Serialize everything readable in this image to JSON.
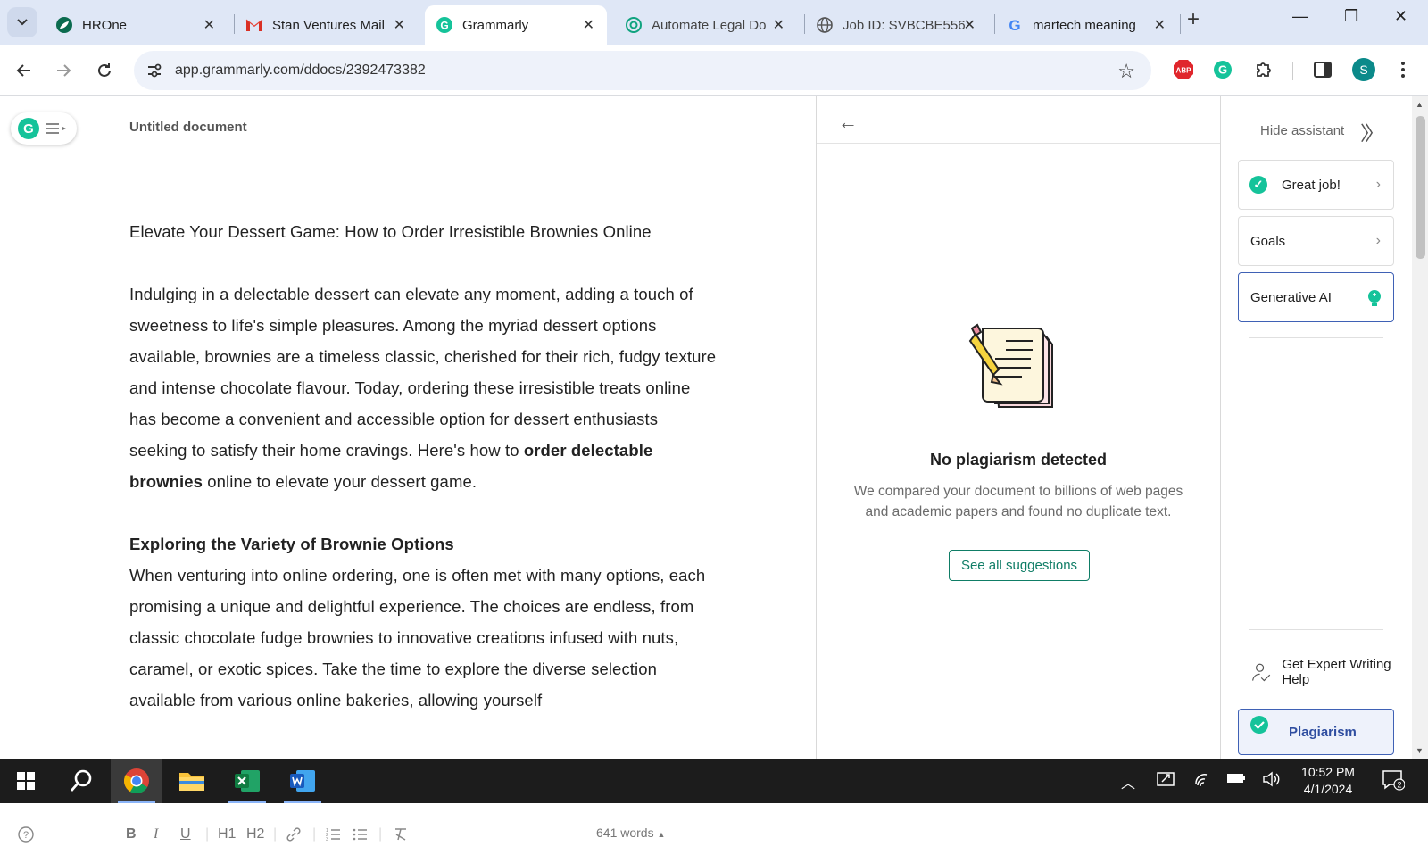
{
  "browser": {
    "tabs": [
      {
        "title": "HROne",
        "icon": "hrone-logo-icon"
      },
      {
        "title": "Stan Ventures Mail",
        "icon": "gmail-icon"
      },
      {
        "title": "Grammarly",
        "icon": "grammarly-icon",
        "active": true
      },
      {
        "title": "Automate Legal Do",
        "icon": "chatgpt-icon"
      },
      {
        "title": "Job ID: SVBCBE556",
        "icon": "globe-icon"
      },
      {
        "title": "martech meaning",
        "icon": "google-icon"
      }
    ],
    "url": "app.grammarly.com/ddocs/2392473382"
  },
  "editor": {
    "doc_title": "Untitled document",
    "heading": "Elevate Your Dessert Game: How to Order Irresistible Brownies Online",
    "para1_a": "Indulging in a delectable dessert can elevate any moment, adding a touch of sweetness to life's simple pleasures. Among the myriad dessert options available, brownies are a timeless classic, cherished for their rich, fudgy texture and intense chocolate flavour. Today, ordering these irresistible treats online has become a convenient and accessible option for dessert enthusiasts seeking to satisfy their home cravings. Here's how to ",
    "para1_bold": "order delectable brownies",
    "para1_b": " online to elevate your dessert game.",
    "subheading": "Exploring the Variety of Brownie Options",
    "para2": "When venturing into online ordering, one is often met with many options, each promising a unique and delightful experience. The choices are endless, from classic chocolate fudge brownies to innovative creations infused with nuts, caramel, or exotic spices. Take the time to explore the diverse selection available from various online bakeries, allowing yourself",
    "word_count": "641 words",
    "format_buttons": [
      "B",
      "I",
      "U",
      "H1",
      "H2"
    ]
  },
  "plagiarism_panel": {
    "title": "No plagiarism detected",
    "description": "We compared your document to billions of web pages and academic papers and found no duplicate text.",
    "button": "See all suggestions"
  },
  "sidebar": {
    "hide_assistant": "Hide assistant",
    "cards": [
      {
        "label": "Great job!"
      },
      {
        "label": "Goals"
      },
      {
        "label": "Generative AI"
      }
    ],
    "expert": "Get Expert Writing Help",
    "plagiarism": "Plagiarism"
  },
  "taskbar": {
    "time": "10:52 PM",
    "date": "4/1/2024",
    "notification_count": "2"
  },
  "colors": {
    "grammarly_green": "#15c39a",
    "accent_blue": "#3f61b5",
    "teal_button": "#0f7d66"
  }
}
